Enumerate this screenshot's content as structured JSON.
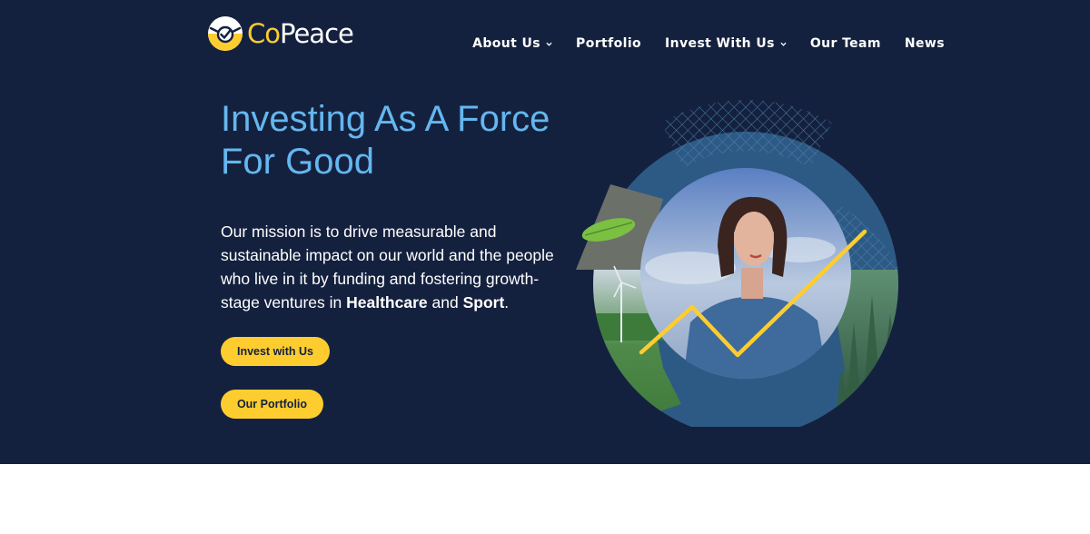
{
  "brand": {
    "name_part1": "Co",
    "name_part2": "Peace"
  },
  "nav": {
    "items": [
      {
        "label": "About Us",
        "dropdown": true
      },
      {
        "label": "Portfolio",
        "dropdown": false
      },
      {
        "label": "Invest With Us",
        "dropdown": true
      },
      {
        "label": "Our Team",
        "dropdown": false
      },
      {
        "label": "News",
        "dropdown": false
      }
    ]
  },
  "hero": {
    "headline_line1": "Investing As A Force",
    "headline_line2": "For Good",
    "mission_prefix": "Our mission is to drive measurable and sustainable impact on our world and the people who live in it by funding and fostering growth-stage ventures in ",
    "mission_bold1": "Healthcare",
    "mission_and": " and ",
    "mission_bold2": "Sport",
    "mission_suffix": ".",
    "cta_invest": "Invest with Us",
    "cta_portfolio": "Our Portfolio"
  },
  "colors": {
    "hero_bg": "#14213e",
    "accent_yellow": "#fdcd2f",
    "headline_blue": "#64b7f0",
    "ring_blue": "#2d5a85"
  },
  "icons": {
    "logo": "copeace-logo-icon",
    "chevron": "chevron-down-icon"
  }
}
